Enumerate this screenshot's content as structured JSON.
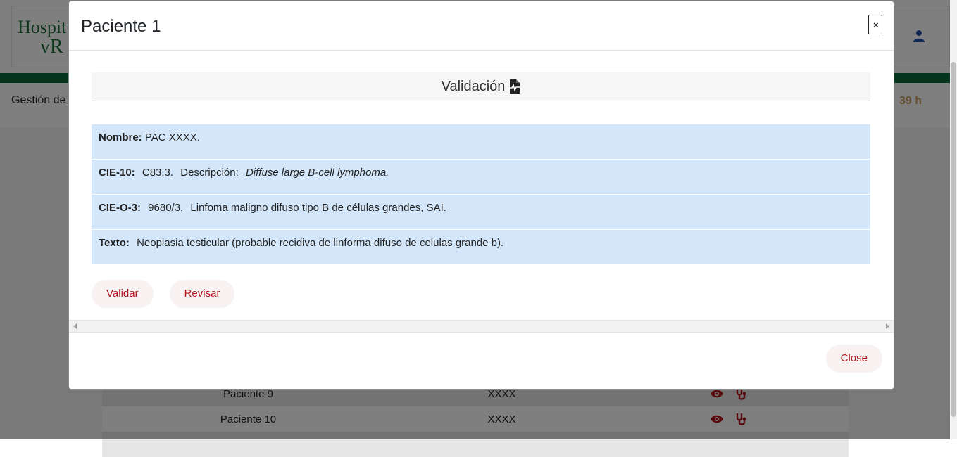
{
  "background": {
    "logo_line1": "Hospit",
    "logo_line2": "vR",
    "subheader_title": "Gestión de",
    "time_fragment": "39 h",
    "table_rows": [
      {
        "name": "Paciente 9",
        "code": "XXXX"
      },
      {
        "name": "Paciente 10",
        "code": "XXXX"
      }
    ]
  },
  "modal": {
    "title": "Paciente 1",
    "close_x": "×",
    "section_title": "Validación",
    "rows": {
      "nombre": {
        "label": "Nombre:",
        "value": "PAC XXXX."
      },
      "cie10": {
        "label": "CIE-10:",
        "code": "C83.3.",
        "desc_label": "Descripción:",
        "desc": "Diffuse large B-cell lymphoma."
      },
      "cieo3": {
        "label": "CIE-O-3:",
        "code": "9680/3.",
        "desc": "Linfoma maligno difuso tipo B de células grandes, SAI."
      },
      "texto": {
        "label": "Texto:",
        "value": "Neoplasia testicular (probable recidiva de linforma difuso de celulas grande b)."
      }
    },
    "buttons": {
      "validar": "Validar",
      "revisar": "Revisar"
    },
    "footer_close": "Close"
  },
  "colors": {
    "accent_red": "#b0141d",
    "info_blue": "#d4e7fa",
    "brand_green": "#0b6b3a"
  }
}
